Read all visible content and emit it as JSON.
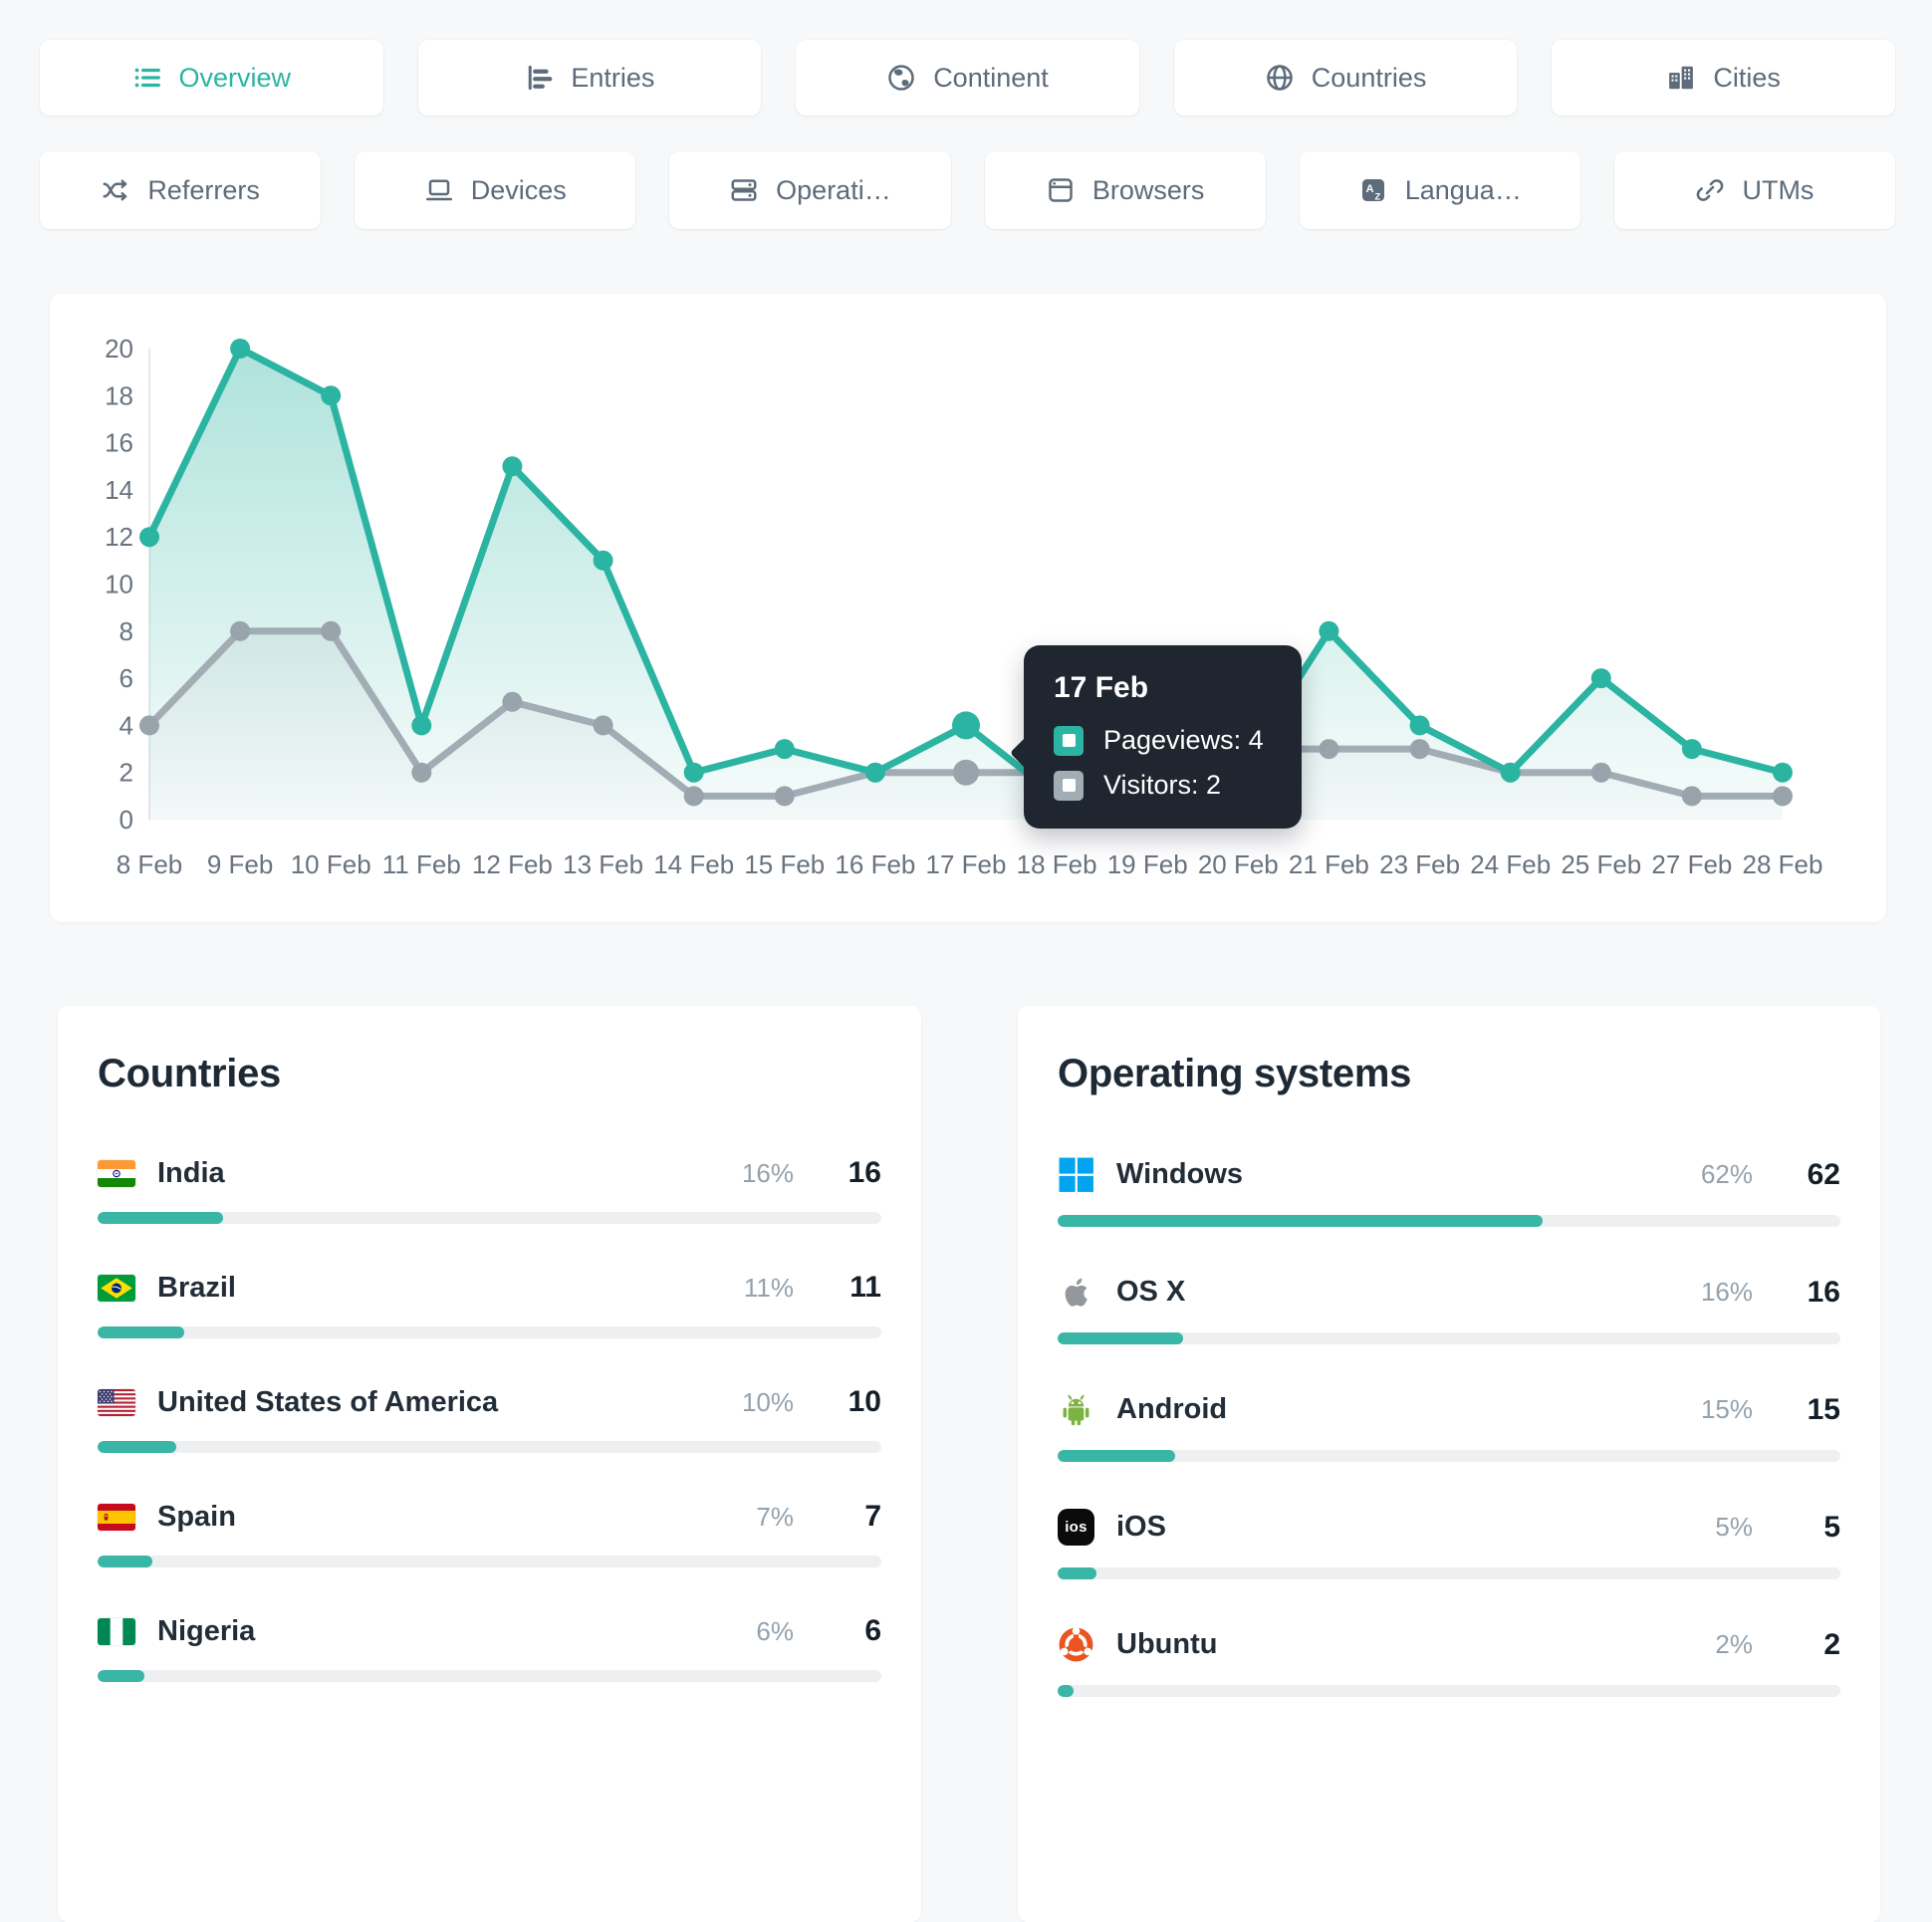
{
  "colors": {
    "accent": "#2cb4a2",
    "gray_line": "#a2acb4",
    "page_bg": "#f6f8f9",
    "tooltip_bg": "#1f2630",
    "bar_fill": "#39b6a6",
    "bar_track": "#edeff1",
    "windows_blue": "#00a4ef",
    "android_green": "#7cb342",
    "ubuntu_orange": "#e95420"
  },
  "tabs": {
    "row1": [
      {
        "label": "Overview",
        "icon": "list-icon",
        "active": true
      },
      {
        "label": "Entries",
        "icon": "entries-icon",
        "active": false
      },
      {
        "label": "Continent",
        "icon": "continent-icon",
        "active": false
      },
      {
        "label": "Countries",
        "icon": "globe-icon",
        "active": false
      },
      {
        "label": "Cities",
        "icon": "buildings-icon",
        "active": false
      }
    ],
    "row2": [
      {
        "label": "Referrers",
        "icon": "shuffle-icon",
        "active": false
      },
      {
        "label": "Devices",
        "icon": "laptop-icon",
        "active": false
      },
      {
        "label": "Operati…",
        "icon": "server-icon",
        "active": false
      },
      {
        "label": "Browsers",
        "icon": "browser-icon",
        "active": false
      },
      {
        "label": "Langua…",
        "icon": "language-icon",
        "active": false
      },
      {
        "label": "UTMs",
        "icon": "link-icon",
        "active": false
      }
    ]
  },
  "chart_data": {
    "type": "line",
    "x": [
      "8 Feb",
      "9 Feb",
      "10 Feb",
      "11 Feb",
      "12 Feb",
      "13 Feb",
      "14 Feb",
      "15 Feb",
      "16 Feb",
      "17 Feb",
      "18 Feb",
      "19 Feb",
      "20 Feb",
      "21 Feb",
      "23 Feb",
      "24 Feb",
      "25 Feb",
      "27 Feb",
      "28 Feb"
    ],
    "series": [
      {
        "name": "Pageviews",
        "color": "#2cb4a2",
        "values": [
          12,
          20,
          18,
          4,
          15,
          11,
          2,
          3,
          2,
          4,
          1,
          1,
          2,
          8,
          4,
          2,
          6,
          3,
          2
        ]
      },
      {
        "name": "Visitors",
        "color": "#a2acb4",
        "values": [
          4,
          8,
          8,
          2,
          5,
          4,
          1,
          1,
          2,
          2,
          2,
          3,
          3,
          3,
          3,
          2,
          2,
          1,
          1
        ]
      }
    ],
    "ylim": [
      0,
      20
    ],
    "ytick_step": 2,
    "grid": false,
    "legend_position": "none",
    "hover_index": 9,
    "tooltip": {
      "date": "17 Feb",
      "rows": [
        {
          "label": "Pageviews",
          "value": 4
        },
        {
          "label": "Visitors",
          "value": 2
        }
      ]
    }
  },
  "panels": {
    "countries": {
      "title": "Countries",
      "rows": [
        {
          "icon": "flag-india-icon",
          "name": "India",
          "pct": 16,
          "value": 16
        },
        {
          "icon": "flag-brazil-icon",
          "name": "Brazil",
          "pct": 11,
          "value": 11
        },
        {
          "icon": "flag-usa-icon",
          "name": "United States of America",
          "pct": 10,
          "value": 10
        },
        {
          "icon": "flag-spain-icon",
          "name": "Spain",
          "pct": 7,
          "value": 7
        },
        {
          "icon": "flag-nigeria-icon",
          "name": "Nigeria",
          "pct": 6,
          "value": 6
        }
      ]
    },
    "os": {
      "title": "Operating systems",
      "rows": [
        {
          "icon": "windows-icon",
          "name": "Windows",
          "pct": 62,
          "value": 62
        },
        {
          "icon": "apple-icon",
          "name": "OS X",
          "pct": 16,
          "value": 16
        },
        {
          "icon": "android-icon",
          "name": "Android",
          "pct": 15,
          "value": 15
        },
        {
          "icon": "ios-icon",
          "name": "iOS",
          "pct": 5,
          "value": 5
        },
        {
          "icon": "ubuntu-icon",
          "name": "Ubuntu",
          "pct": 2,
          "value": 2
        }
      ]
    }
  }
}
